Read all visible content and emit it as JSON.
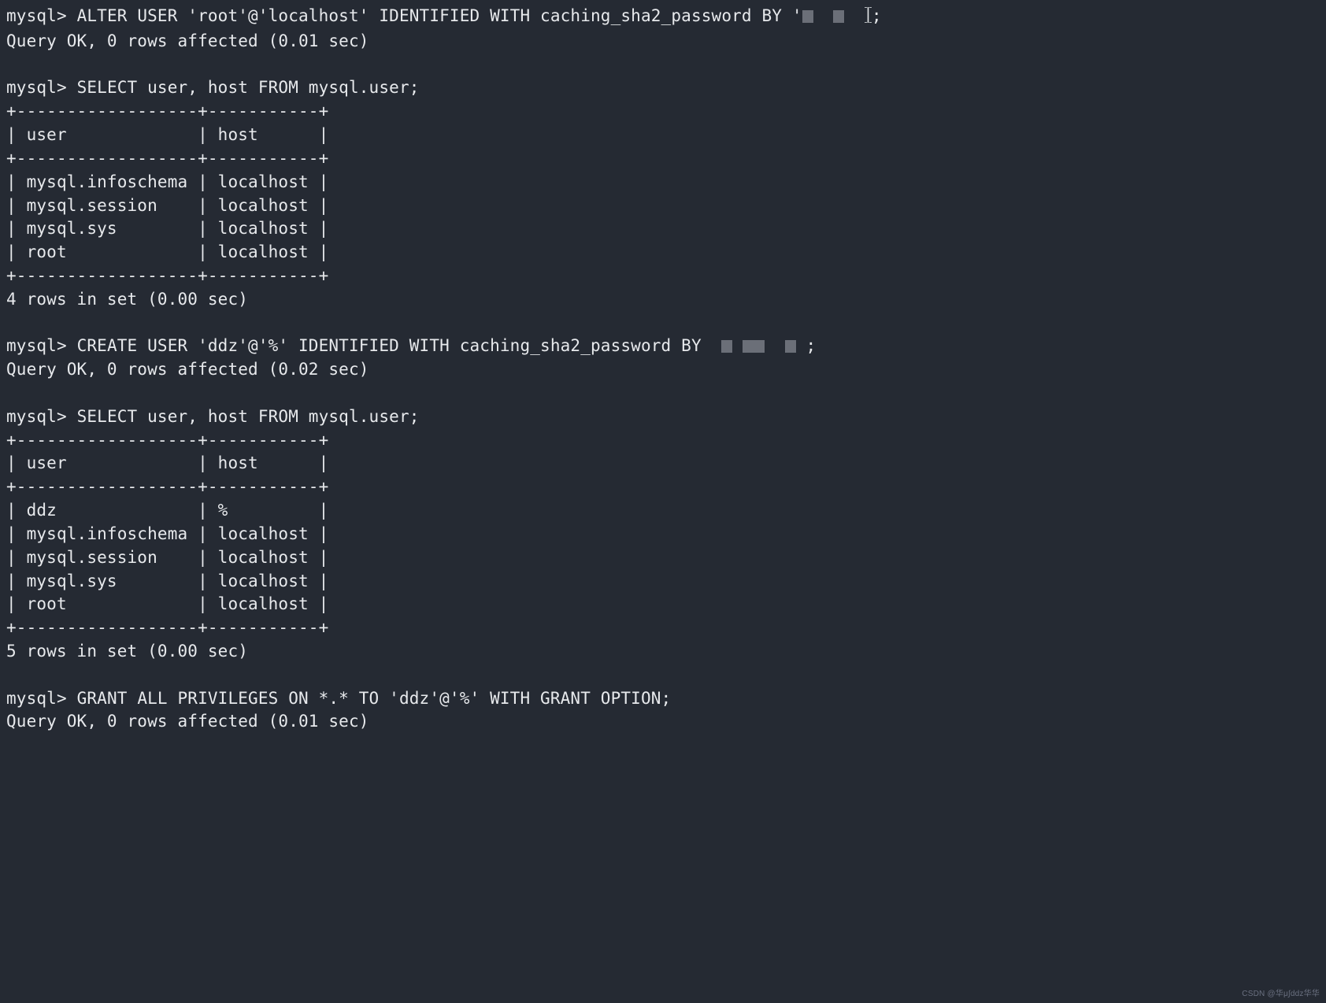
{
  "prompt": "mysql> ",
  "cmd1": {
    "pre": "ALTER USER 'root'@'localhost' IDENTIFIED WITH caching_sha2_password BY '",
    "post": ";",
    "result": "Query OK, 0 rows affected (0.01 sec)"
  },
  "cmd2": {
    "sql": "SELECT user, host FROM mysql.user;",
    "border": "+------------------+-----------+",
    "header": "| user             | host      |",
    "rows": [
      "| mysql.infoschema | localhost |",
      "| mysql.session    | localhost |",
      "| mysql.sys        | localhost |",
      "| root             | localhost |"
    ],
    "summary": "4 rows in set (0.00 sec)"
  },
  "cmd3": {
    "pre": "CREATE USER 'ddz'@'%' IDENTIFIED WITH caching_sha2_password BY ",
    "post": " ;",
    "result": "Query OK, 0 rows affected (0.02 sec)"
  },
  "cmd4": {
    "sql": "SELECT user, host FROM mysql.user;",
    "border": "+------------------+-----------+",
    "header": "| user             | host      |",
    "rows": [
      "| ddz              | %         |",
      "| mysql.infoschema | localhost |",
      "| mysql.session    | localhost |",
      "| mysql.sys        | localhost |",
      "| root             | localhost |"
    ],
    "summary": "5 rows in set (0.00 sec)"
  },
  "cmd5": {
    "sql": "GRANT ALL PRIVILEGES ON *.* TO 'ddz'@'%' WITH GRANT OPTION;",
    "result": "Query OK, 0 rows affected (0.01 sec)"
  },
  "watermark": "CSDN @华μ∫ddz华华"
}
